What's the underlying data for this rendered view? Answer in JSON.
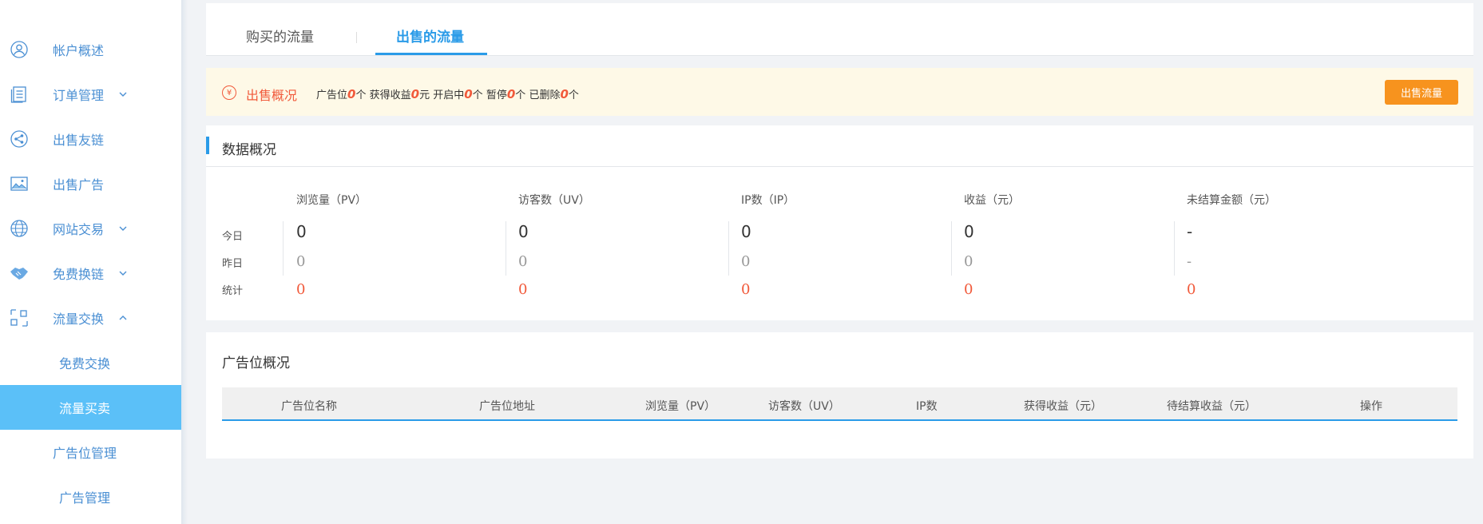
{
  "sidebar": {
    "items": [
      {
        "label": "帐户概述",
        "icon": "user-icon"
      },
      {
        "label": "订单管理",
        "icon": "list-icon",
        "caret": "down"
      },
      {
        "label": "出售友链",
        "icon": "share-icon"
      },
      {
        "label": "出售广告",
        "icon": "image-icon"
      },
      {
        "label": "网站交易",
        "icon": "globe-icon",
        "caret": "down"
      },
      {
        "label": "免费换链",
        "icon": "handshake-icon",
        "caret": "down"
      },
      {
        "label": "流量交换",
        "icon": "exchange-icon",
        "caret": "up"
      }
    ],
    "sub_items": [
      {
        "label": "免费交换"
      },
      {
        "label": "流量买卖",
        "active": true
      },
      {
        "label": "广告位管理"
      },
      {
        "label": "广告管理"
      }
    ]
  },
  "tabs": {
    "buy": "购买的流量",
    "sell": "出售的流量"
  },
  "notice": {
    "icon_char": "¥",
    "title": "出售概况",
    "slots_label": "广告位",
    "slots": "0",
    "unit_count": "个",
    "earned_label": "获得收益",
    "earned": "0",
    "unit_yuan": "元",
    "open_label": "开启中",
    "open": "0",
    "paused_label": "暂停",
    "paused": "0",
    "deleted_label": "已删除",
    "deleted": "0",
    "button": "出售流量"
  },
  "overview": {
    "title": "数据概况",
    "columns": [
      "浏览量（PV）",
      "访客数（UV）",
      "IP数（IP）",
      "收益（元）",
      "未结算金额（元）"
    ],
    "row_labels": [
      "今日",
      "昨日",
      "统计"
    ],
    "today": [
      "0",
      "0",
      "0",
      "0",
      "-"
    ],
    "yesterday": [
      "0",
      "0",
      "0",
      "0",
      "-"
    ],
    "total": [
      "0",
      "0",
      "0",
      "0",
      "0"
    ]
  },
  "adslot": {
    "title": "广告位概况",
    "headers": [
      "广告位名称",
      "广告位地址",
      "浏览量（PV）",
      "访客数（UV）",
      "IP数",
      "获得收益（元）",
      "待结算收益（元）",
      "操作"
    ]
  },
  "colors": {
    "accent_blue": "#2a9be8",
    "active_bg": "#5bc0f8",
    "orange": "#f7931e",
    "red": "#f15a3b"
  }
}
